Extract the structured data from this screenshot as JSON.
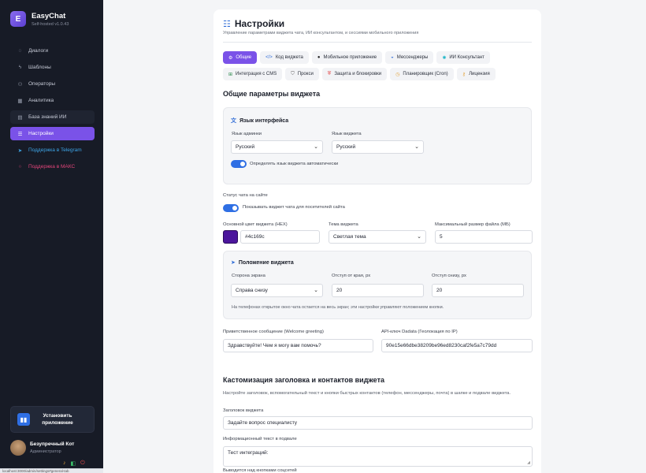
{
  "brand": {
    "logo": "E",
    "name": "EasyChat",
    "version": "Self-hosted v1.0.43"
  },
  "nav": [
    {
      "icon": "chat-icon",
      "glyph": "◌",
      "label": "Диалоги"
    },
    {
      "icon": "bolt-icon",
      "glyph": "ϟ",
      "label": "Шаблоны"
    },
    {
      "icon": "users-icon",
      "glyph": "⚇",
      "label": "Операторы"
    },
    {
      "icon": "chart-icon",
      "glyph": "▦",
      "label": "Аналитика"
    },
    {
      "icon": "database-icon",
      "glyph": "▤",
      "label": "База знаний ИИ"
    },
    {
      "icon": "settings-icon",
      "glyph": "☰",
      "label": "Настройки"
    },
    {
      "icon": "telegram-icon",
      "glyph": "➤",
      "label": "Поддержка в Telegram"
    },
    {
      "icon": "max-icon",
      "glyph": "○",
      "label": "Поддержка в МАКС"
    }
  ],
  "install": {
    "label": "Установить приложение",
    "icon": "app-icon"
  },
  "user": {
    "name": "Безупречный Кот",
    "role": "Администратор"
  },
  "statusbar": "localhost:3000/admin/settings#general-tab",
  "header": {
    "title": "Настройки",
    "subtitle": "Управление параметрами виджета чата, ИИ консультантом, и сессиями мобильного приложения"
  },
  "tabs_row1": [
    {
      "icon": "gear-icon",
      "glyph": "⚙",
      "label": "Общие",
      "active": true
    },
    {
      "icon": "code-icon",
      "glyph": "</>",
      "label": "Код виджета"
    },
    {
      "icon": "mobile-icon",
      "glyph": "●",
      "label": "Мобильное приложение"
    },
    {
      "icon": "messenger-icon",
      "glyph": "◒",
      "label": "Мессенджеры"
    },
    {
      "icon": "ai-icon",
      "glyph": "✺",
      "label": "ИИ Консультант"
    }
  ],
  "tabs_row2": [
    {
      "icon": "cms-icon",
      "glyph": "⊞",
      "label": "Интеграция с CMS"
    },
    {
      "icon": "proxy-icon",
      "glyph": "⛉",
      "label": "Прокси"
    },
    {
      "icon": "shield-icon",
      "glyph": "⛨",
      "label": "Защита и блокировки"
    },
    {
      "icon": "clock-icon",
      "glyph": "◷",
      "label": "Планировщик (Cron)"
    },
    {
      "icon": "key-icon",
      "glyph": "⚷",
      "label": "Лицензия"
    }
  ],
  "general": {
    "title": "Общие параметры виджета",
    "lang_card_title": "Язык интерфейса",
    "admin_lang_label": "Язык админки",
    "admin_lang_value": "Русский",
    "widget_lang_label": "Язык виджета",
    "widget_lang_value": "Русский",
    "auto_lang_label": "Определять язык виджета автоматически",
    "auto_lang_on": true,
    "chat_status_label": "Статус чата на сайте",
    "show_widget_label": "Показывать виджет чата для посетителей сайта",
    "show_widget_on": true,
    "color_label": "Основной цвет виджета (HEX)",
    "color_value": "#4c169c",
    "theme_label": "Тема виджета",
    "theme_value": "Светлая тема",
    "max_file_label": "Максимальный размер файла (МБ)",
    "max_file_value": "5"
  },
  "position": {
    "title": "Положение виджета",
    "side_label": "Сторона экрана",
    "side_value": "Справа снизу",
    "offset_x_label": "Отступ от края, px",
    "offset_x_value": "20",
    "offset_y_label": "Отступ снизу, px",
    "offset_y_value": "20",
    "note": "На телефонах открытое окно чата остается на весь экран; эти настройки управляют положением кнопки."
  },
  "welcome": {
    "label": "Приветственное сообщение (Welcome greeting)",
    "value": "Здравствуйте! Чем я могу вам помочь?"
  },
  "dadata": {
    "label": "API-ключ Dadata (Геолокация по IP)",
    "value": "90e15e66dbe38209be96ed8230caf2fe5a7c79dd"
  },
  "custom": {
    "title": "Кастомизация заголовка и контактов виджета",
    "desc": "Настройте заголовок, вспомогательный текст и кнопки быстрых контактов (телефон, мессенджеры, почта) в шапке и подвале виджета.",
    "header_label": "Заголовок виджета",
    "header_value": "Задайте вопрос специалисту",
    "footer_label": "Информационный текст в подвале",
    "footer_value": "Тест интеграций:",
    "above_buttons_label": "Выводится над кнопками соцсетей"
  }
}
